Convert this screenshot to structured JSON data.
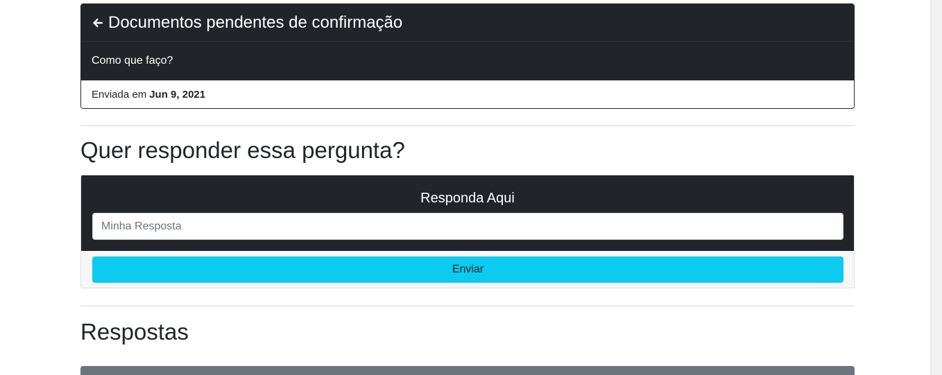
{
  "question": {
    "title": "Documentos pendentes de confirmação",
    "body": "Como que faço?",
    "sent_prefix": "Enviada em",
    "sent_date": "Jun 9, 2021"
  },
  "reply_section": {
    "heading": "Quer responder essa pergunta?",
    "card_label": "Responda Aqui",
    "input_placeholder": "Minha Resposta",
    "input_value": "",
    "submit_label": "Enviar"
  },
  "answers_section": {
    "heading": "Respostas"
  },
  "colors": {
    "dark": "#212529",
    "info_button": "#0dcaf0",
    "answer_card_header": "#6c757d"
  },
  "icons": {
    "back": "arrow-left-icon"
  }
}
